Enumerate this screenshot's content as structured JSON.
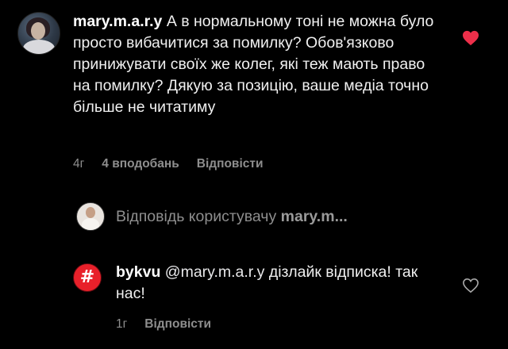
{
  "comment": {
    "username": "mary.m.a.r.y",
    "text": "А в нормальному тоні не можна було просто вибачитися за помилку? Обов'язково принижувати своїх же колег, які теж мають право на помилку? Дякую за позицію, ваше медіа точно більше не читатиму",
    "time": "4г",
    "likes": "4 вподобань",
    "reply_label": "Відповісти",
    "liked": true,
    "heart_color": "#ed2f4a"
  },
  "thread": {
    "label": "Відповідь користувачу",
    "user": "mary.m..."
  },
  "reply": {
    "username": "bykvu",
    "avatar_glyph": "#",
    "avatar_color": "#e8202a",
    "mention": "@mary.m.a.r.y",
    "text": "дізлайк відписка! так нас!",
    "time": "1г",
    "reply_label": "Відповісти",
    "liked": false
  }
}
